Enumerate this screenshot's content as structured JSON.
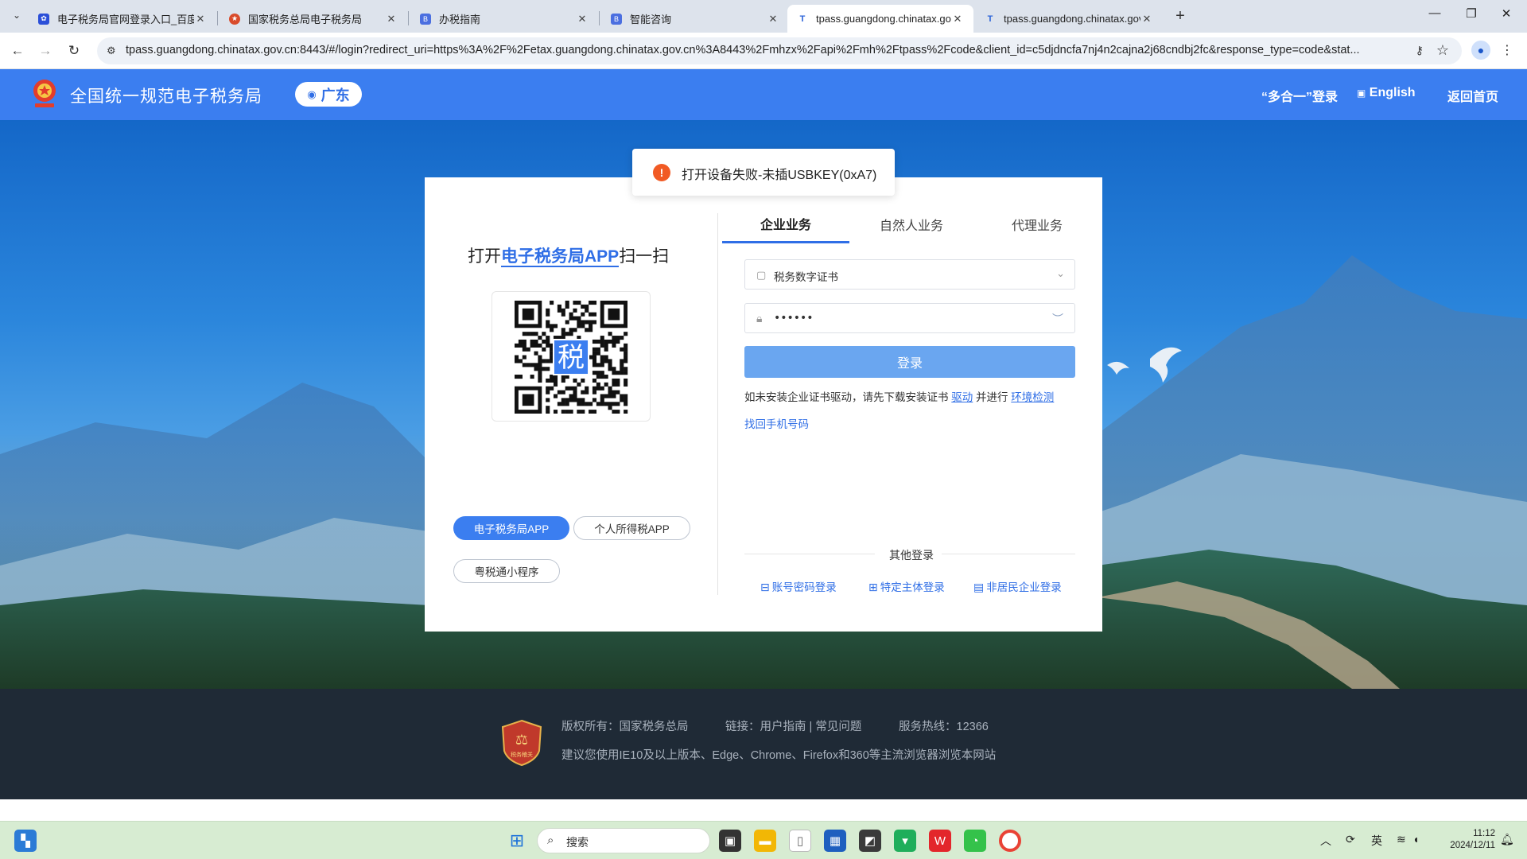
{
  "browser": {
    "tabs": [
      {
        "title": "电子税务局官网登录入口_百度搜索",
        "favicon": "paw-icon",
        "color": "#2b4fd8"
      },
      {
        "title": "国家税务总局电子税务局",
        "favicon": "tax-emblem-icon",
        "color": "#d94b2b"
      },
      {
        "title": "办税指南",
        "favicon": "guide-icon",
        "color": "#4b6fe0"
      },
      {
        "title": "智能咨询",
        "favicon": "guide-icon",
        "color": "#4b6fe0"
      },
      {
        "title": "tpass.guangdong.chinatax.gov.cn",
        "favicon": "tpass-icon",
        "color": "#2b63d9",
        "active": true
      },
      {
        "title": "tpass.guangdong.chinatax.gov.cn",
        "favicon": "tpass-icon",
        "color": "#2b63d9"
      }
    ],
    "url": "tpass.guangdong.chinatax.gov.cn:8443/#/login?redirect_uri=https%3A%2F%2Fetax.guangdong.chinatax.gov.cn%3A8443%2Fmhzx%2Fapi%2Fmh%2Ftpass%2Fcode&client_id=c5djdncfa7nj4n2cajna2j68cndbj2fc&response_type=code&stat..."
  },
  "header": {
    "site_title": "全国统一规范电子税务局",
    "region": "广东",
    "link_multi_login": "“多合一”登录",
    "link_english": "English",
    "link_home": "返回首页"
  },
  "toast": {
    "message": "打开设备失败-未插USBKEY(0xA7)"
  },
  "qr_panel": {
    "title_prefix": "打开",
    "title_highlight": "电子税务局APP",
    "title_suffix": "扫一扫",
    "qr_center_char": "税",
    "btn_etax_app": "电子税务局APP",
    "btn_personal_tax_app": "个人所得税APP",
    "btn_mini_program": "粤税通小程序"
  },
  "login": {
    "tabs": [
      "企业业务",
      "自然人业务",
      "代理业务"
    ],
    "active_tab": 0,
    "cert_select_value": "税务数字证书",
    "password_value": "••••••",
    "login_button": "登录",
    "hint_prefix": "如未安装企业证书驱动，请先下载安装证书",
    "hint_driver_link": "驱动",
    "hint_middle": "并进行",
    "hint_env_link": "环境检测",
    "recover_phone": "找回手机号码",
    "other_login_title": "其他登录",
    "other_account": "账号密码登录",
    "other_specific": "特定主体登录",
    "other_nonresident": "非居民企业登录"
  },
  "footer": {
    "copyright": "版权所有：国家税务总局",
    "links_label": "链接：",
    "link_guide": "用户指南",
    "link_faq": "常见问题",
    "hotline": "服务热线：12366",
    "browser_advice": "建议您使用IE10及以上版本、Edge、Chrome、Firefox和360等主流浏览器浏览本网站",
    "logo_text": "税务稽关"
  },
  "taskbar": {
    "search_placeholder": "搜索",
    "ime": "英",
    "time": "11:12",
    "date": "2024/12/11"
  },
  "colors": {
    "brand_blue": "#3b7ef0",
    "login_button": "#6aa6f0",
    "error": "#f15a24",
    "footer_bg": "#1f2a36"
  }
}
